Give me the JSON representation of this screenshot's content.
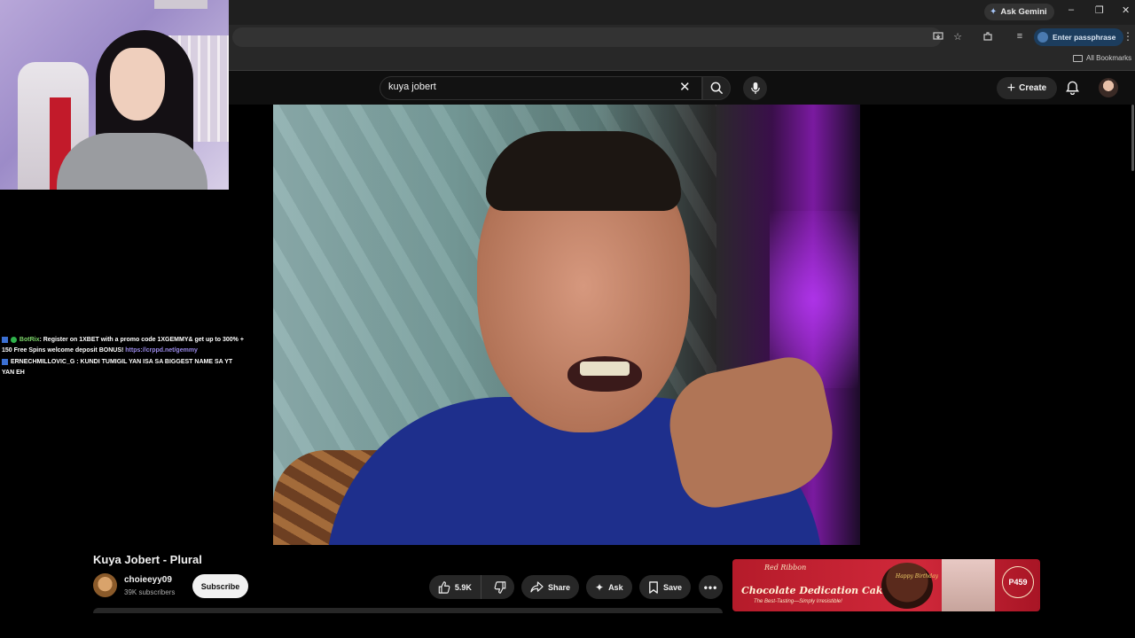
{
  "browser": {
    "ask_gemini": "Ask Gemini",
    "passphrase_label": "Enter passphrase",
    "all_bookmarks": "All Bookmarks"
  },
  "youtube": {
    "search_value": "kuya jobert",
    "create_label": "Create"
  },
  "chat": [
    {
      "user": "BotRix",
      "message": ": Register on 1XBET with a promo code 1XGEMMY& get up to 300% + 150 Free Spins welcome deposit BONUS! ",
      "link": "https://crppd.net/gemmy"
    },
    {
      "user": "ERNECHMILLOVIC_G",
      "message": " : KUNDI TUMIGIL YAN ISA SA BIGGEST NAME SA YT YAN EH"
    }
  ],
  "video": {
    "title": "Kuya Jobert - Plural",
    "channel_name": "choieeyy09",
    "subscribers": "39K subscribers",
    "subscribe_label": "Subscribe",
    "likes": "5.9K",
    "share_label": "Share",
    "ask_label": "Ask",
    "save_label": "Save"
  },
  "ad": {
    "brand": "Red Ribbon",
    "headline": "Chocolate Dedication Cake",
    "tagline": "The Best-Tasting—Simply Irresistible!",
    "cake_text": "Happy Birthday",
    "price": "P459"
  },
  "icons": {
    "search": "search-icon",
    "mic": "mic-icon",
    "bell": "bell-icon",
    "like": "thumbs-up-icon",
    "dislike": "thumbs-down-icon",
    "share": "share-icon",
    "ask": "sparkle-icon",
    "save": "bookmark-icon"
  }
}
